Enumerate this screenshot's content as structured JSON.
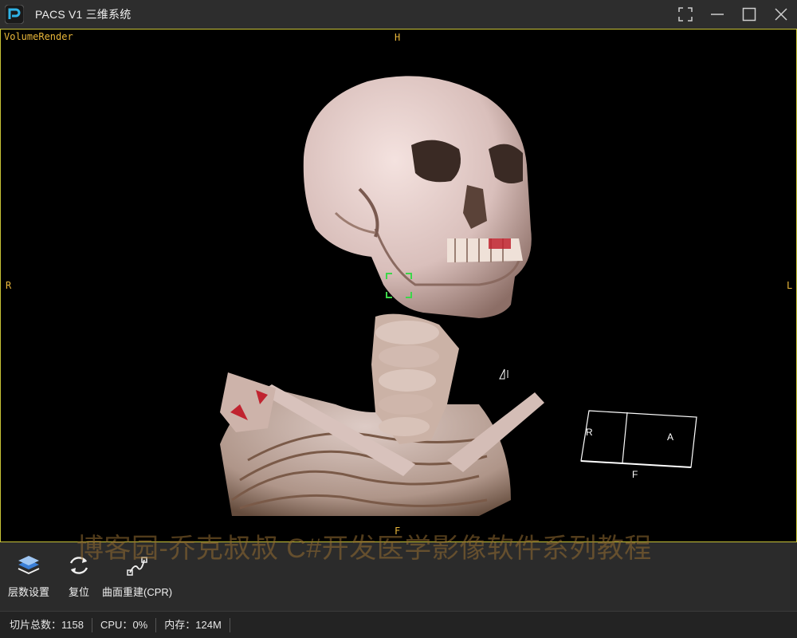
{
  "window": {
    "title": "PACS V1 三维系统",
    "controls": [
      "fullscreen-icon",
      "minimize-icon",
      "maximize-icon",
      "close-icon"
    ]
  },
  "viewport": {
    "mode_label": "VolumeRender",
    "orientation": {
      "top": "H",
      "left": "R",
      "right": "L",
      "bottom": "F"
    },
    "orientation_cube": {
      "left_face": "R",
      "front_face": "A",
      "bottom": "F"
    },
    "border_color": "#c9c437",
    "overlay_color": "#e8b63a"
  },
  "watermark": "博客园-乔克叔叔 C#开发医学影像软件系列教程",
  "toolbar": {
    "items": [
      {
        "label": "层数设置",
        "icon": "layers-icon"
      },
      {
        "label": "复位",
        "icon": "reset-icon"
      },
      {
        "label": "曲面重建(CPR)",
        "icon": "curve-icon"
      }
    ]
  },
  "status": {
    "slices_label": "切片总数：",
    "slices_value": "1158",
    "cpu_label": "CPU：",
    "cpu_value": "0%",
    "memory_label": "内存：",
    "memory_value": "124M"
  }
}
